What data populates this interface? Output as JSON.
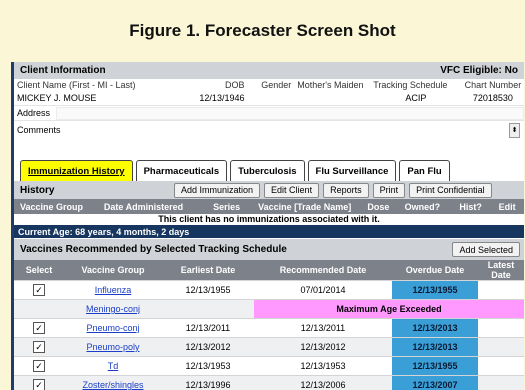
{
  "figure_title": "Figure 1. Forecaster Screen Shot",
  "client_info": {
    "title": "Client Information",
    "vfc_label": "VFC Eligible:",
    "vfc_value": "No",
    "labels": [
      "Client Name (First - MI - Last)",
      "DOB",
      "Gender",
      "Mother's Maiden",
      "Tracking Schedule",
      "Chart Number"
    ],
    "values": {
      "name": "MICKEY J. MOUSE",
      "dob": "12/13/1946",
      "gender": "",
      "mothers_maiden": "",
      "tracking_schedule": "ACIP",
      "chart_number": "72018530"
    },
    "address_label": "Address",
    "comments_label": "Comments"
  },
  "tabs": [
    "Immunization History",
    "Pharmaceuticals",
    "Tuberculosis",
    "Flu Surveillance",
    "Pan Flu"
  ],
  "history": {
    "title": "History",
    "buttons": [
      "Add Immunization",
      "Edit Client",
      "Reports",
      "Print",
      "Print Confidential"
    ],
    "columns": [
      "Vaccine Group",
      "Date Administered",
      "Series",
      "Vaccine [Trade Name]",
      "Dose",
      "Owned?",
      "Hist?",
      "Edit"
    ],
    "empty_message": "This client has no immunizations associated with it."
  },
  "current_age": "Current Age: 68 years, 4 months, 2 days",
  "recommended": {
    "title": "Vaccines Recommended by Selected Tracking Schedule",
    "add_selected_label": "Add Selected",
    "columns": [
      "Select",
      "Vaccine Group",
      "Earliest Date",
      "Recommended Date",
      "Overdue Date",
      "Latest Date"
    ],
    "rows": [
      {
        "vaccine": "Influenza",
        "earliest": "12/13/1955",
        "recommended": "07/01/2014",
        "overdue": "12/13/1955",
        "latest": ""
      },
      {
        "vaccine": "Meningo-conj",
        "message": "Maximum Age Exceeded"
      },
      {
        "vaccine": "Pneumo-conj",
        "earliest": "12/13/2011",
        "recommended": "12/13/2011",
        "overdue": "12/13/2013",
        "latest": ""
      },
      {
        "vaccine": "Pneumo-poly",
        "earliest": "12/13/2012",
        "recommended": "12/13/2012",
        "overdue": "12/13/2013",
        "latest": ""
      },
      {
        "vaccine": "Td",
        "earliest": "12/13/1953",
        "recommended": "12/13/1953",
        "overdue": "12/13/1955",
        "latest": ""
      },
      {
        "vaccine": "Zoster/shingles",
        "earliest": "12/13/1996",
        "recommended": "12/13/2006",
        "overdue": "12/13/2007",
        "latest": ""
      }
    ]
  },
  "colors": {
    "page_bg": "#fbf6d6",
    "nav_dark": "#16365f",
    "header_gray": "#7d8189",
    "overdue": "#3a9fd6",
    "max_age": "#ff99ff",
    "active_tab": "#ffff00"
  }
}
